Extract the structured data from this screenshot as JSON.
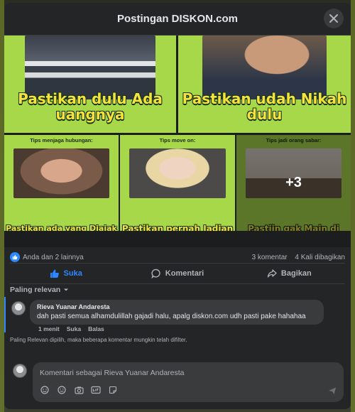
{
  "modal": {
    "title": "Postingan DISKON.com"
  },
  "media": {
    "tiles": [
      {
        "tip": "",
        "caption": "Pastikan dulu Ada uangnya"
      },
      {
        "tip": "",
        "caption": "Pastikan udah Nikah dulu"
      },
      {
        "tip": "Tips menjaga hubungan:",
        "caption": "Pastikan ada yang Diajak hubungan dulu"
      },
      {
        "tip": "Tips move on:",
        "caption": "Pastikan pernah Jadian dulu"
      },
      {
        "tip": "Tips jadi orang sabar:",
        "caption": "Pastiin gak Main di Ranked"
      }
    ],
    "more_count": "+3"
  },
  "stats": {
    "reactions": "Anda dan 2 lainnya",
    "comments": "3 komentar",
    "shares": "4 Kali dibagikan"
  },
  "actions": {
    "like": "Suka",
    "comment": "Komentari",
    "share": "Bagikan"
  },
  "sort": {
    "label": "Paling relevan"
  },
  "comment": {
    "author": "Rieva Yuanar Andaresta",
    "text": "dah pasti semua alhamdulillah gajadi halu, apalg diskon.com udh pasti pake hahahaa",
    "time": "1 menit",
    "like": "Suka",
    "reply": "Balas"
  },
  "filter_note": "Paling Relevan dipilih, maka beberapa komentar mungkin telah difilter.",
  "composer": {
    "placeholder": "Komentari sebagai Rieva Yuanar Andaresta"
  },
  "colors": {
    "accent": "#2d88ff",
    "surface": "#242526",
    "bubble": "#3a3b3c",
    "caption": "#f6e23a",
    "tile_bg": "#a6d84a"
  },
  "icons": [
    "close-icon",
    "like-icon",
    "comment-icon",
    "share-icon",
    "chevron-down-icon",
    "sticker-icon",
    "emoji-icon",
    "camera-icon",
    "gif-icon",
    "avatar-sticker-icon",
    "send-icon"
  ]
}
